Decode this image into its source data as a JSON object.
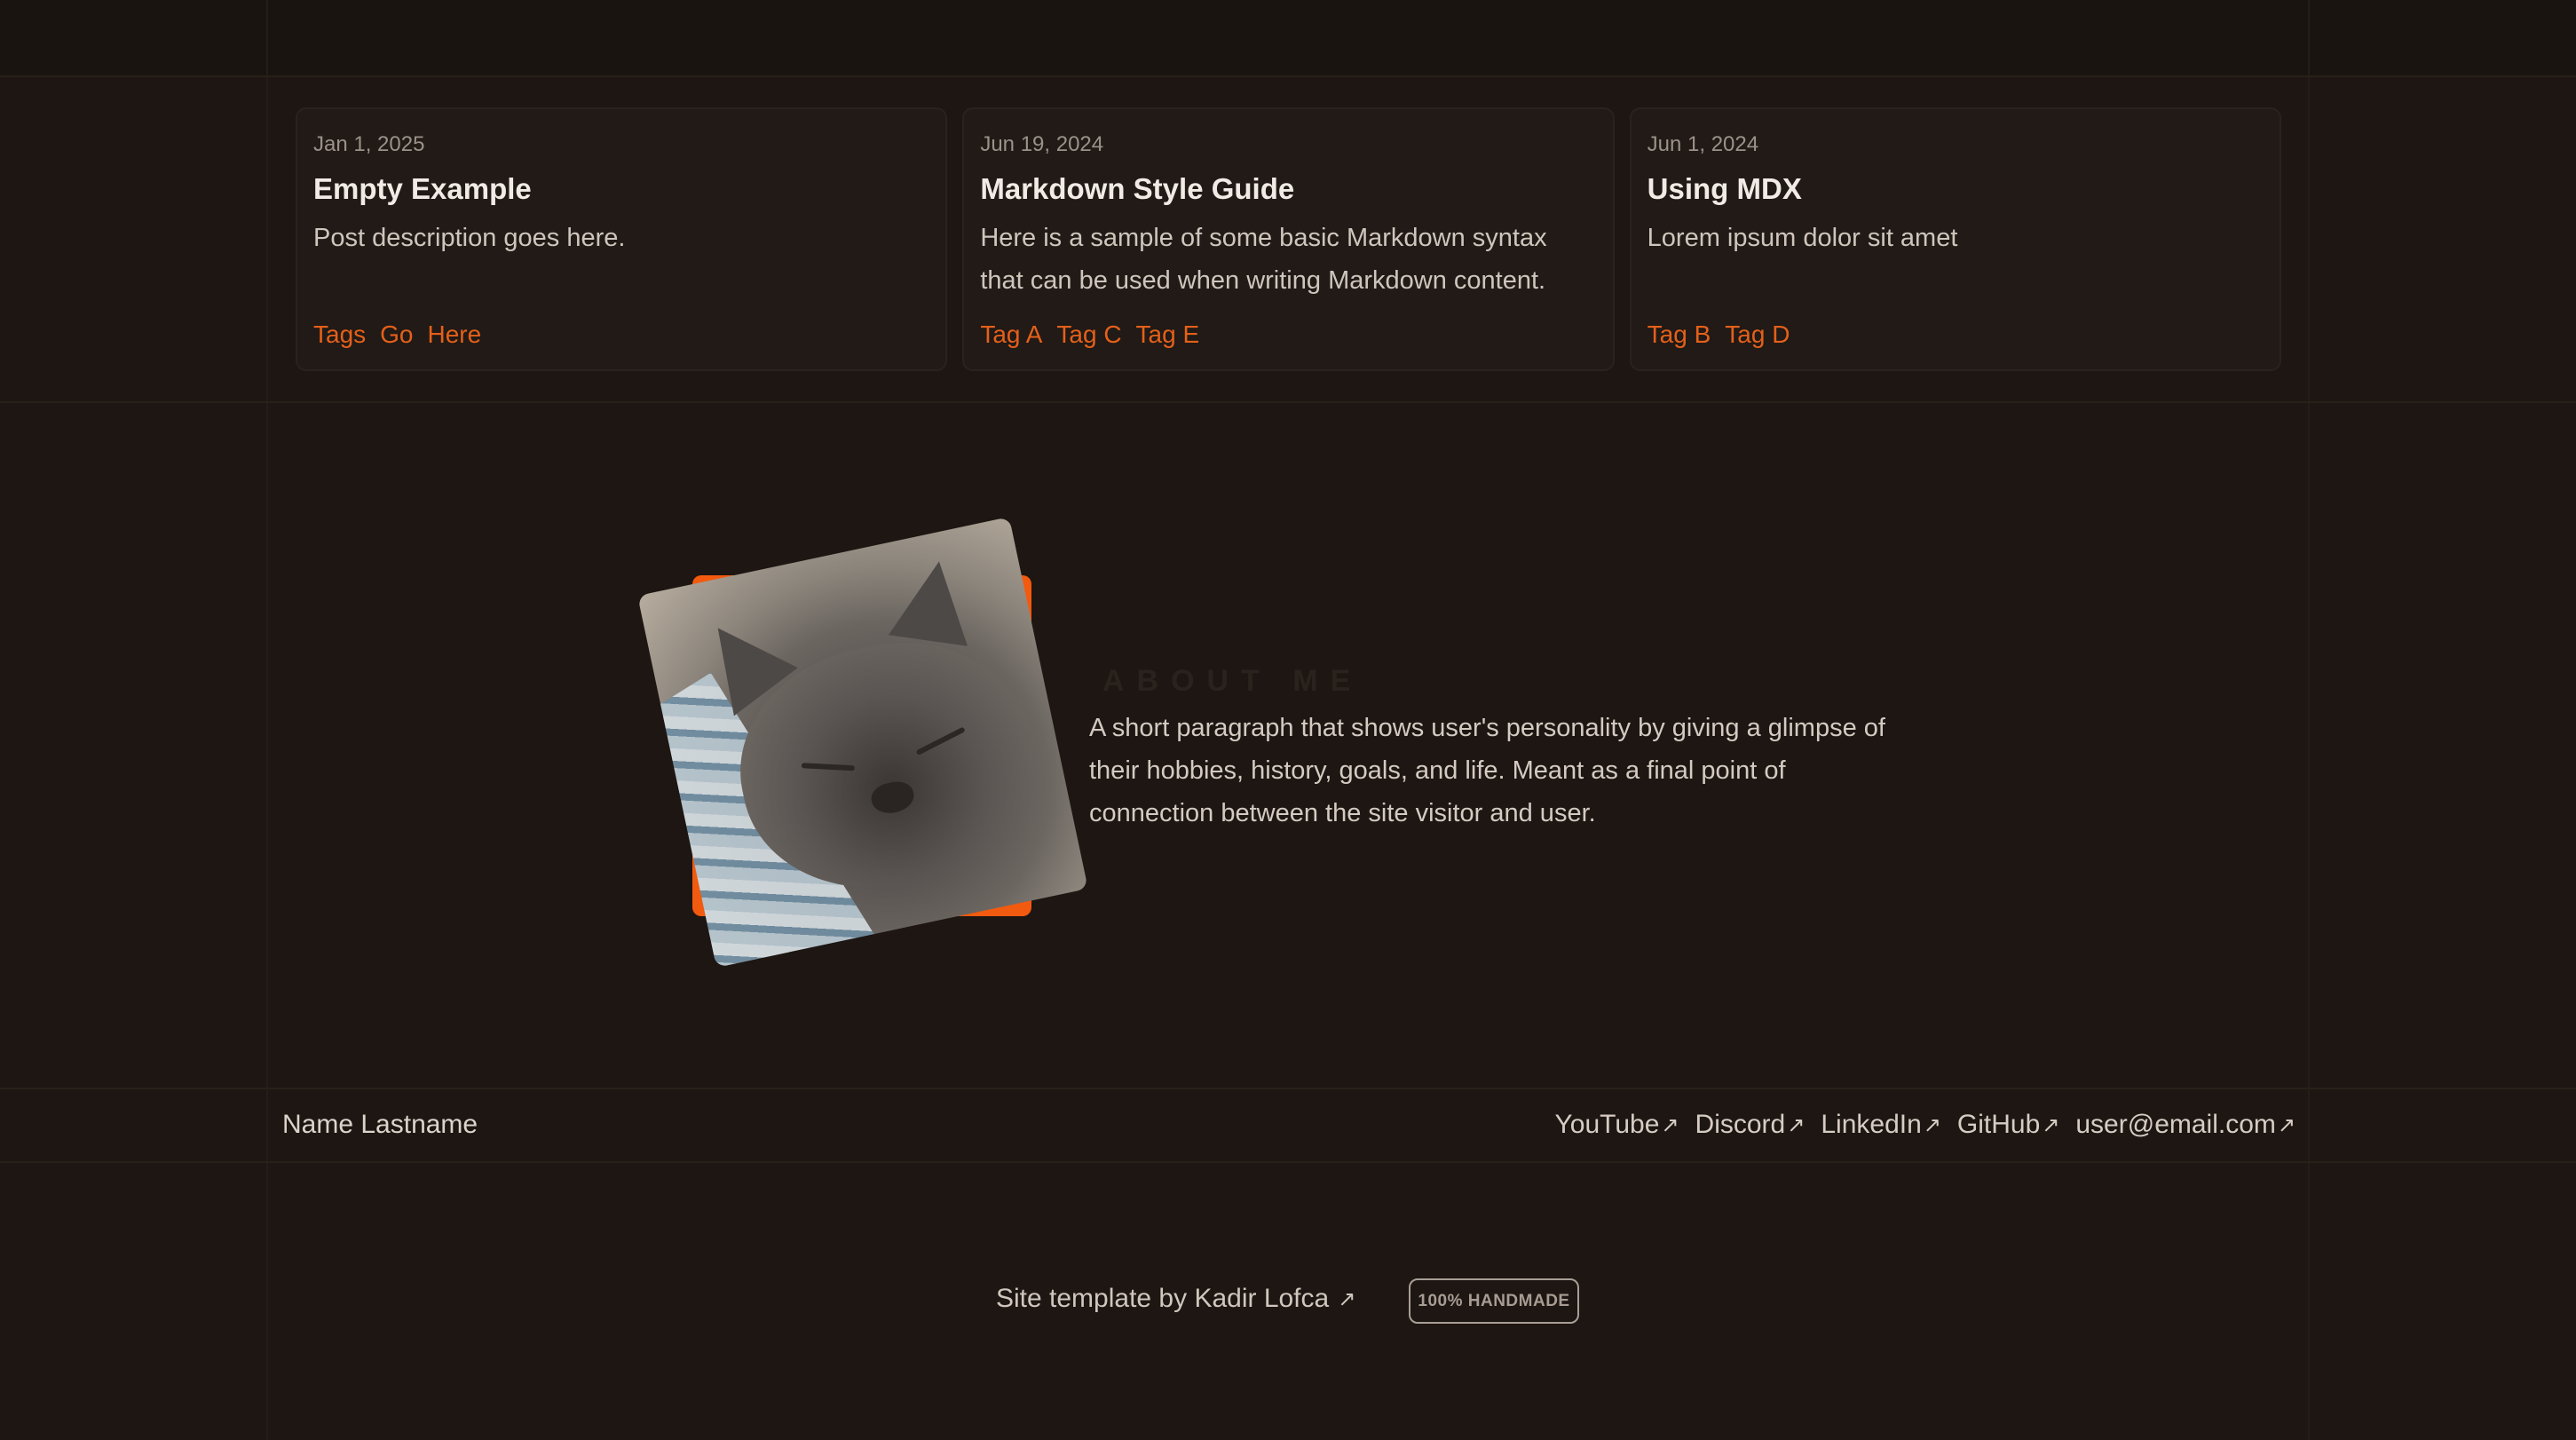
{
  "posts": [
    {
      "date": "Jan 1, 2025",
      "title": "Empty Example",
      "description": "Post description goes here.",
      "tags": [
        "Tags",
        "Go",
        "Here"
      ]
    },
    {
      "date": "Jun 19, 2024",
      "title": "Markdown Style Guide",
      "description": "Here is a sample of some basic Markdown syntax that can be used when writing Markdown content.",
      "tags": [
        "Tag A",
        "Tag C",
        "Tag E"
      ]
    },
    {
      "date": "Jun 1, 2024",
      "title": "Using MDX",
      "description": "Lorem ipsum dolor sit amet",
      "tags": [
        "Tag B",
        "Tag D"
      ]
    }
  ],
  "about": {
    "label": "ABOUT ME",
    "text": "A short paragraph that shows user's personality by giving a glimpse of their hobbies, history, goals, and life. Meant as a final point of connection between the site visitor and user."
  },
  "footer": {
    "name": "Name Lastname",
    "links": [
      "YouTube",
      "Discord",
      "LinkedIn",
      "GitHub",
      "user@email.com"
    ],
    "arrow_glyph": "↗",
    "credit": "Site template by Kadir Lofca",
    "badge": "100% HANDMADE"
  },
  "colors": {
    "accent": "#e4601a",
    "photo_backdrop": "#f25a0f",
    "background": "#1d1612"
  },
  "icons": {
    "external_link": "arrow-up-right-icon",
    "photo": "cat-photo"
  }
}
